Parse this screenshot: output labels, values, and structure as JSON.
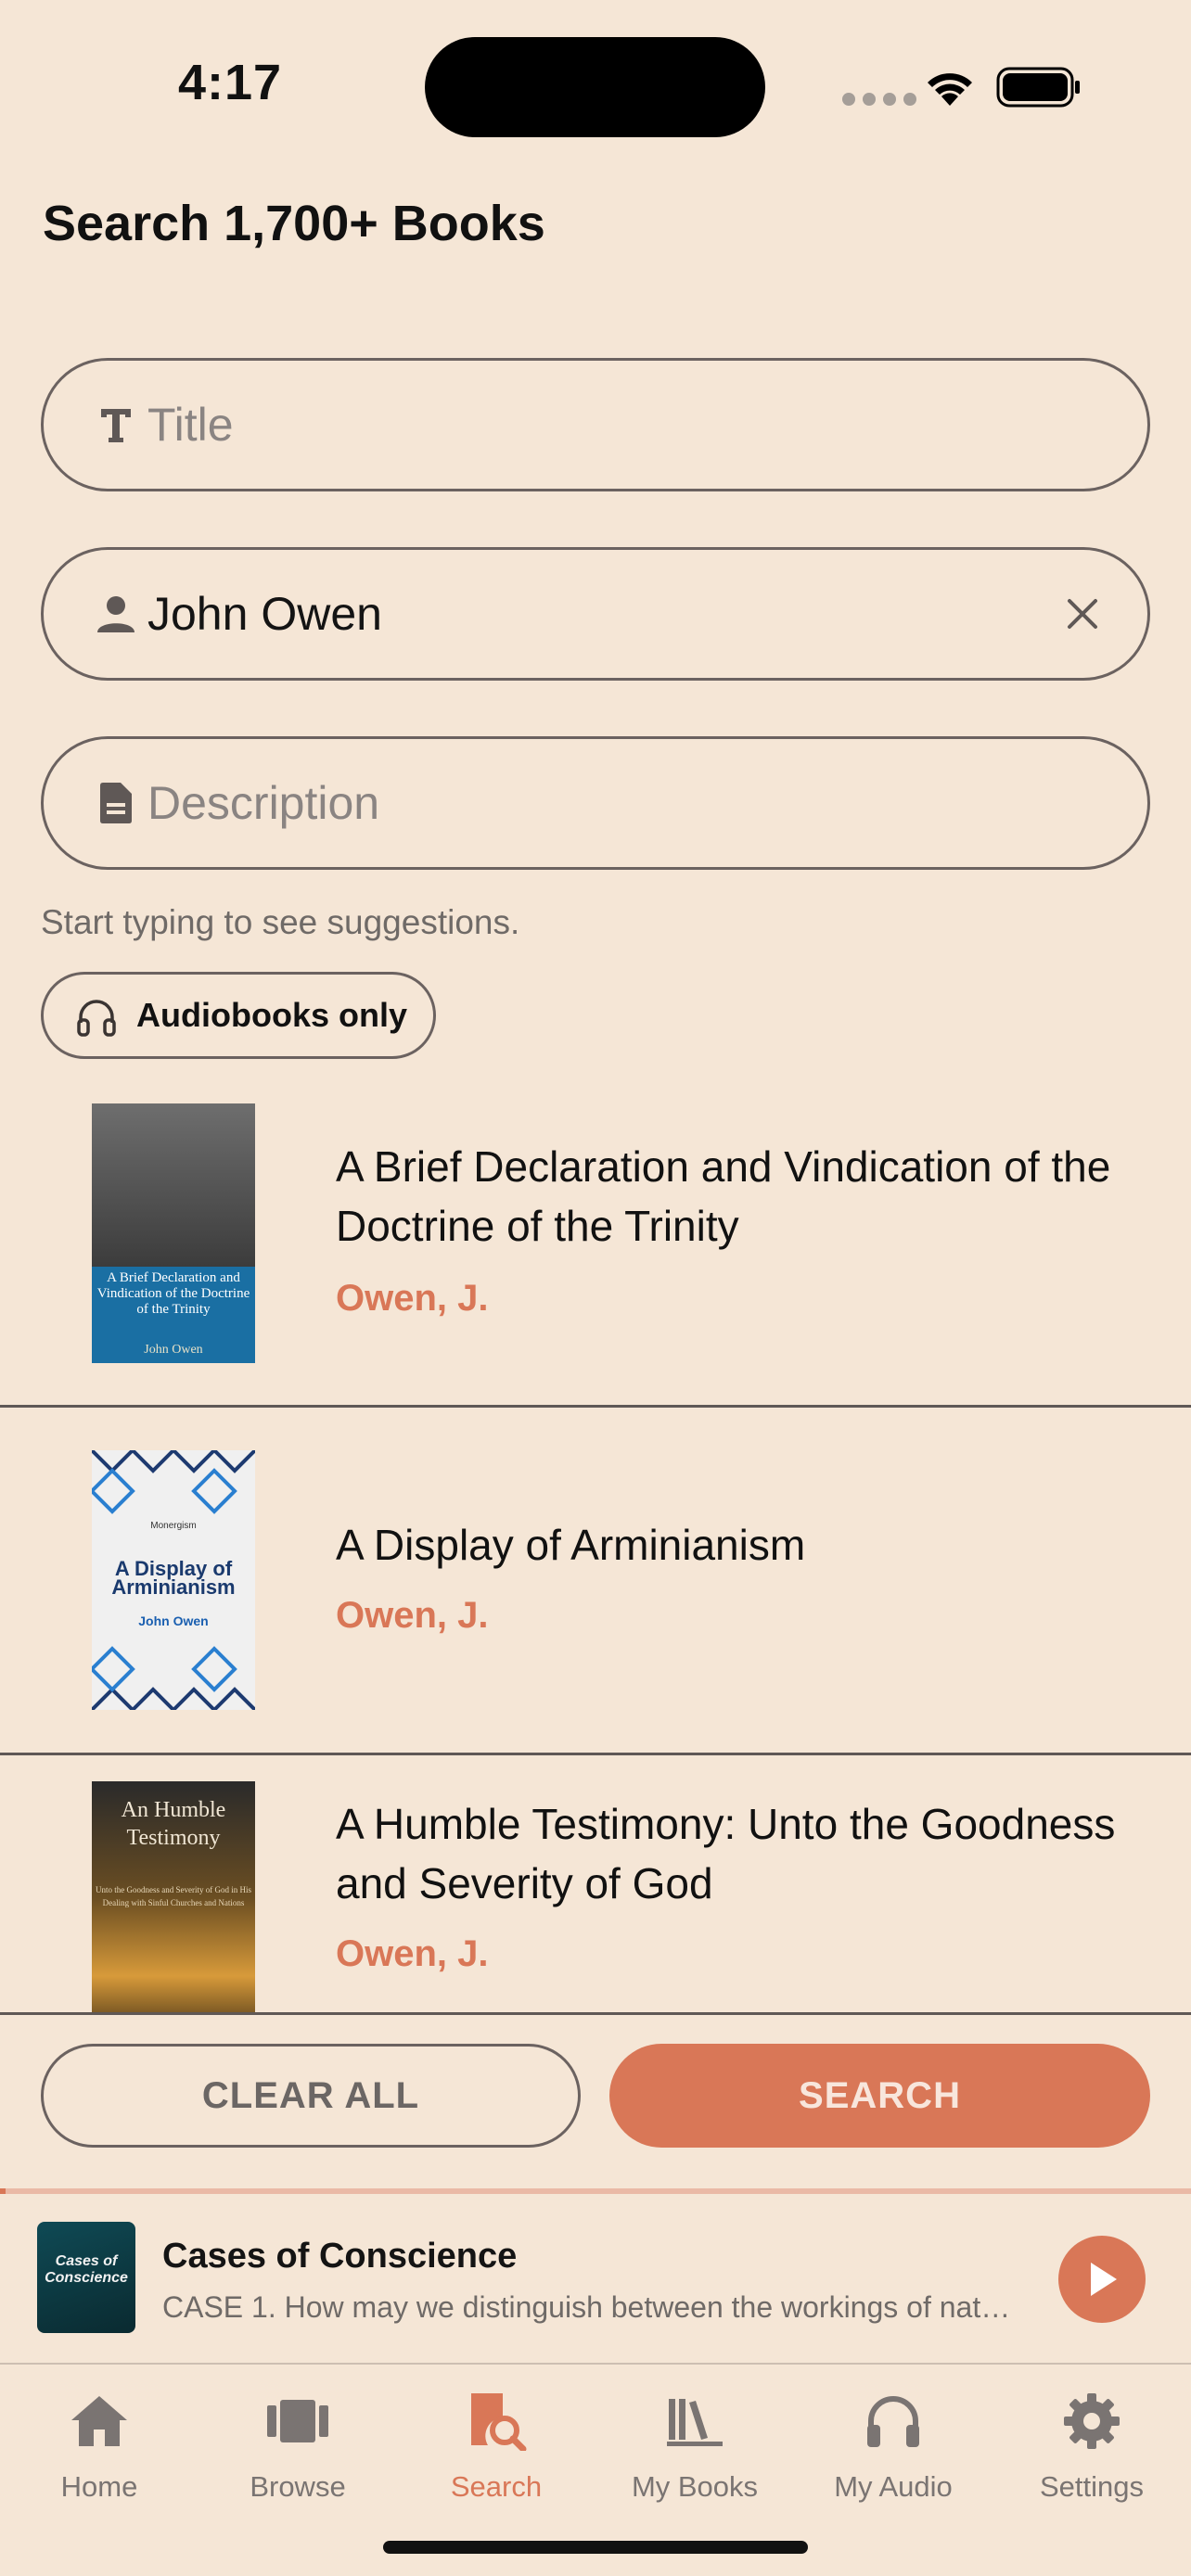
{
  "status_bar": {
    "time": "4:17"
  },
  "page": {
    "title": "Search 1,700+ Books"
  },
  "search": {
    "title_placeholder": "Title",
    "author_value": "John Owen",
    "description_placeholder": "Description",
    "hint": "Start typing to see suggestions.",
    "audiobooks_chip_label": "Audiobooks only"
  },
  "results": [
    {
      "title": "A Brief Declaration and Vindication of the Doctrine of the Trinity",
      "author": "Owen, J.",
      "cover_title": "A Brief Declaration and Vindication of the Doctrine of the Trinity",
      "cover_author": "John Owen"
    },
    {
      "title": "A Display of Arminianism",
      "author": "Owen, J.",
      "cover_publisher": "Monergism",
      "cover_title": "A Display of Arminianism",
      "cover_author": "John Owen"
    },
    {
      "title": "A Humble Testimony: Unto the Goodness and Severity of God",
      "author": "Owen, J.",
      "cover_title": "An Humble Testimony",
      "cover_subtitle": "Unto the Goodness and Severity of God in His Dealing with Sinful Churches and Nations"
    }
  ],
  "actions": {
    "clear_all": "CLEAR ALL",
    "search": "SEARCH"
  },
  "player": {
    "title": "Cases of Conscience",
    "subtitle": "CASE 1. How may we distinguish between the workings of nat…",
    "art_title": "Cases of Conscience",
    "progress": 0.005
  },
  "tabs": [
    {
      "label": "Home",
      "icon": "home-icon",
      "active": false
    },
    {
      "label": "Browse",
      "icon": "books-icon",
      "active": false
    },
    {
      "label": "Search",
      "icon": "book-search-icon",
      "active": true
    },
    {
      "label": "My Books",
      "icon": "library-icon",
      "active": false
    },
    {
      "label": "My Audio",
      "icon": "headphones-icon",
      "active": false
    },
    {
      "label": "Settings",
      "icon": "gear-icon",
      "active": false
    }
  ],
  "colors": {
    "background": "#f5e6d6",
    "accent": "#d97757",
    "text": "#111111",
    "muted": "#7a7472"
  }
}
